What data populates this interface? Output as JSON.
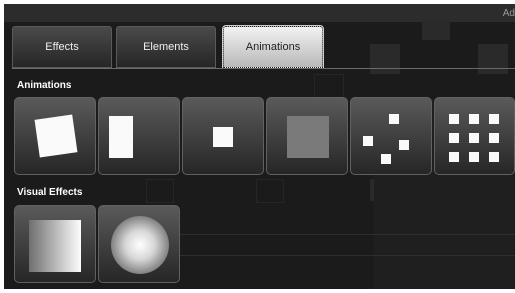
{
  "window": {
    "title": "Ad"
  },
  "tabs": [
    {
      "label": "Effects"
    },
    {
      "label": "Elements"
    },
    {
      "label": "Animations",
      "active": true
    }
  ],
  "sections": {
    "animations": {
      "label": "Animations",
      "tiles": [
        {
          "icon": "tilted-square-icon"
        },
        {
          "icon": "tall-rectangle-icon"
        },
        {
          "icon": "small-square-icon"
        },
        {
          "icon": "gray-square-icon"
        },
        {
          "icon": "scattered-squares-icon"
        },
        {
          "icon": "square-grid-icon"
        }
      ]
    },
    "visual_effects": {
      "label": "Visual Effects",
      "tiles": [
        {
          "icon": "linear-gradient-icon"
        },
        {
          "icon": "radial-gradient-icon"
        }
      ]
    }
  },
  "colors": {
    "panel_bg": "#1b1b1b",
    "tab_active_bg": "#dcdcdc",
    "tile_border": "#616161",
    "icon_white": "#fafafa"
  }
}
